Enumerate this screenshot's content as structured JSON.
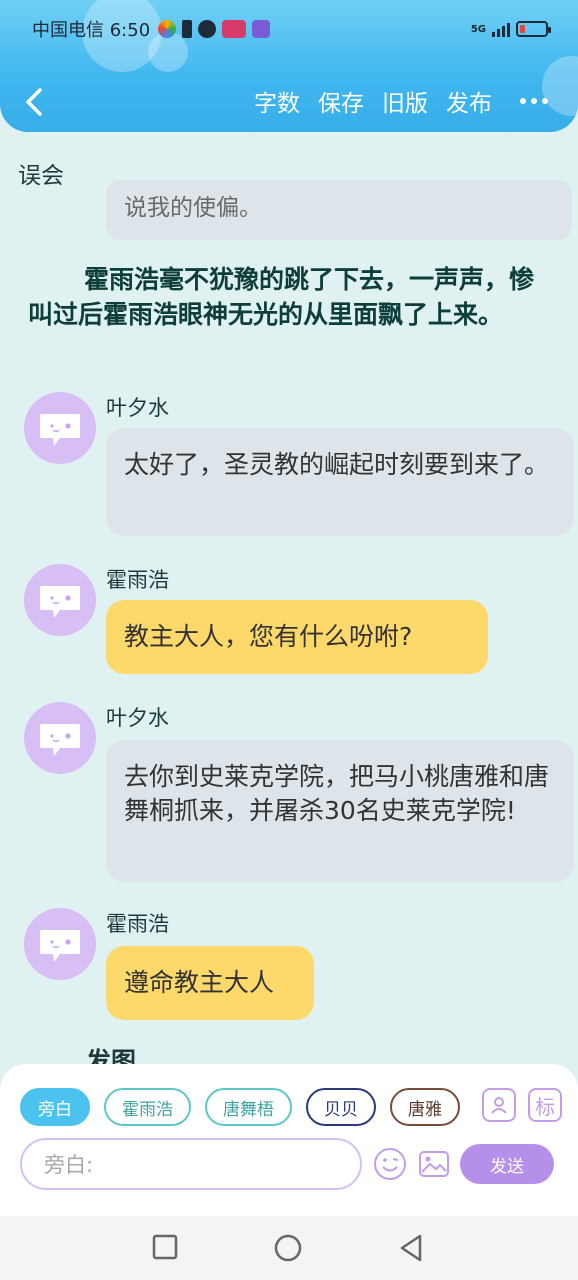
{
  "status_bar": {
    "carrier_time": "中国电信 6:50",
    "network": "5G",
    "battery_color": "#e0463f"
  },
  "toolbar": {
    "back_icon": "chevron-left-icon",
    "word_count": "字数",
    "save": "保存",
    "old_version": "旧版",
    "publish": "发布",
    "more_icon": "more-horizontal-icon"
  },
  "page": {
    "title": "误会",
    "clipped_text": "说我的使偏。"
  },
  "narration": "霍雨浩毫不犹豫的跳了下去，一声声，惨叫过后霍雨浩眼神无光的从里面飘了上来。",
  "messages": [
    {
      "sender": "叶夕水",
      "text": "太好了，圣灵教的崛起时刻要到来了。",
      "style": "gray"
    },
    {
      "sender": "霍雨浩",
      "text": "教主大人，您有什么吩咐?",
      "style": "yellow"
    },
    {
      "sender": "叶夕水",
      "text": "去你到史莱克学院，把马小桃唐雅和唐舞桐抓来，并屠杀30名史莱克学院!",
      "style": "gray"
    },
    {
      "sender": "霍雨浩",
      "text": "遵命教主大人",
      "style": "yellow"
    }
  ],
  "partial_next": "发图",
  "role_chips": [
    {
      "label": "旁白",
      "active": true,
      "color": "#4cc3ef"
    },
    {
      "label": "霍雨浩",
      "color": "#5cc7c7"
    },
    {
      "label": "唐舞梧",
      "color": "#5cc7c7"
    },
    {
      "label": "贝贝",
      "color": "#2a3a7a"
    },
    {
      "label": "唐雅",
      "color": "#7a4a3a"
    }
  ],
  "tools": {
    "person_icon": "person-card-icon",
    "mark_label": "标"
  },
  "composer": {
    "placeholder": "旁白:",
    "send_label": "发送"
  },
  "system_nav": [
    "square-icon",
    "circle-icon",
    "triangle-back-icon"
  ],
  "colors": {
    "accent_blue": "#3fb6ef",
    "purple": "#b58fea",
    "bubble_gray": "#dde4ea",
    "bubble_yellow": "#fdd96c"
  }
}
